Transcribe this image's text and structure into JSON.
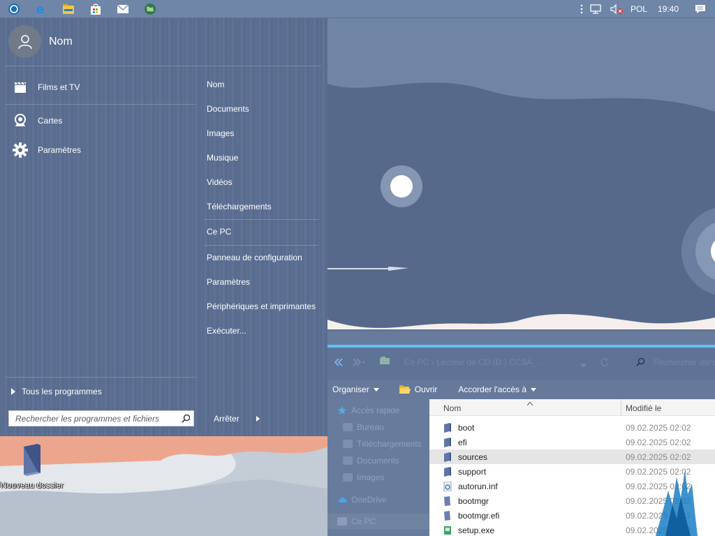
{
  "taskbar": {
    "pinned": [
      {
        "name": "start-orb-icon"
      },
      {
        "name": "edge-icon"
      },
      {
        "name": "file-explorer-icon"
      },
      {
        "name": "store-icon"
      },
      {
        "name": "mail-icon"
      },
      {
        "name": "globe-app-icon"
      }
    ],
    "tray": {
      "language": "POL",
      "time": "19:40",
      "icons": [
        "tray-overflow-icon",
        "network-icon",
        "volume-muted-icon",
        "action-center-icon"
      ]
    }
  },
  "start_menu": {
    "user_name": "Nom",
    "left_items": [
      {
        "label": "Films et TV",
        "icon": "clapperboard-icon"
      },
      {
        "label": "Cartes",
        "icon": "maps-icon"
      },
      {
        "label": "Paramètres",
        "icon": "gear-icon"
      }
    ],
    "right_items_group1": [
      "Nom",
      "Documents",
      "Images",
      "Musique",
      "Vidéos",
      "Téléchargements"
    ],
    "right_items_group2": [
      "Ce PC"
    ],
    "right_items_group3": [
      "Panneau de configuration",
      "Paramètres",
      "Périphériques et imprimantes",
      "Exécuter..."
    ],
    "all_programs": "Tous les programmes",
    "search_placeholder": "Rechercher les programmes et fichiers",
    "shutdown_label": "Arrêter"
  },
  "desktop": {
    "icons": [
      {
        "label": "Nouveau dossier",
        "icon": "folder-icon"
      }
    ]
  },
  "explorer": {
    "address_path": "Ce PC  ›  Lecteur de CD (D:) CCSA_...",
    "search_placeholder": "Rechercher dans",
    "toolbar": {
      "organize": "Organiser",
      "open": "Ouvrir",
      "share": "Accorder l'accès à"
    },
    "nav": [
      {
        "label": "Accès rapide",
        "icon": "star-icon"
      },
      {
        "label": "Bureau",
        "icon": "desktop-folder-icon"
      },
      {
        "label": "Téléchargements",
        "icon": "downloads-folder-icon"
      },
      {
        "label": "Documents",
        "icon": "documents-folder-icon"
      },
      {
        "label": "Images",
        "icon": "images-folder-icon"
      },
      {
        "label": "OneDrive",
        "icon": "cloud-icon"
      },
      {
        "label": "Ce PC",
        "icon": "computer-icon"
      }
    ],
    "columns": {
      "name": "Nom",
      "modified": "Modifié le"
    },
    "files": [
      {
        "name": "boot",
        "modified": "09.02.2025 02:02",
        "icon": "folder-icon",
        "selected": false
      },
      {
        "name": "efi",
        "modified": "09.02.2025 02:02",
        "icon": "folder-icon",
        "selected": false
      },
      {
        "name": "sources",
        "modified": "09.02.2025 02:02",
        "icon": "folder-icon",
        "selected": true
      },
      {
        "name": "support",
        "modified": "09.02.2025 02:02",
        "icon": "folder-icon",
        "selected": false
      },
      {
        "name": "autorun.inf",
        "modified": "09.02.2025 02:02",
        "icon": "settings-file-icon",
        "selected": false
      },
      {
        "name": "bootmgr",
        "modified": "09.02.2025 02:02",
        "icon": "file-icon",
        "selected": false
      },
      {
        "name": "bootmgr.efi",
        "modified": "09.02.2025 02:02",
        "icon": "file-icon",
        "selected": false
      },
      {
        "name": "setup.exe",
        "modified": "09.02.2025 02:02",
        "icon": "setup-icon",
        "selected": false
      }
    ]
  }
}
